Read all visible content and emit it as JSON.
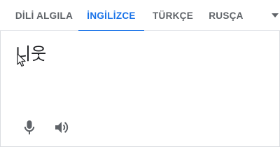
{
  "tabs": [
    {
      "label": "DİLİ ALGILA",
      "active": false
    },
    {
      "label": "İNGİLİZCE",
      "active": true
    },
    {
      "label": "TÜRKÇE",
      "active": false
    },
    {
      "label": "RUSÇA",
      "active": false
    }
  ],
  "input": {
    "text": "니웃"
  },
  "icons": {
    "more_languages": "chevron-down-icon",
    "voice_input": "microphone-icon",
    "listen": "speaker-icon",
    "pointer": "mouse-cursor-icon"
  },
  "colors": {
    "accent": "#1a73e8",
    "tab_text": "#5f6368",
    "icon": "#5f6368",
    "text": "#202124"
  }
}
